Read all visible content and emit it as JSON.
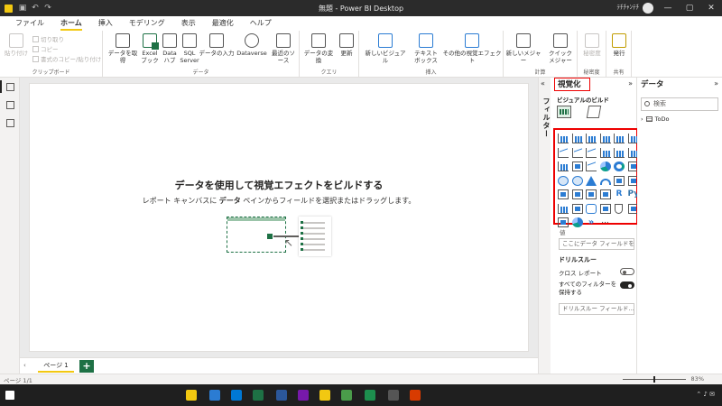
{
  "window": {
    "title": "無題 - Power BI Desktop",
    "user": "ﾃﾁﾁｬﾝﾃﾁ"
  },
  "menu": {
    "tabs": [
      "ファイル",
      "ホーム",
      "挿入",
      "モデリング",
      "表示",
      "最適化",
      "ヘルプ"
    ],
    "active": "ホーム"
  },
  "ribbon": {
    "clipboard": {
      "paste": "貼り付け",
      "cut": "切り取り",
      "copy": "コピー",
      "format_painter": "書式のコピー/貼り付け",
      "label": "クリップボード"
    },
    "data": {
      "get_data": "データを取得",
      "excel": "Excel ブック",
      "datahub": "Data ハブ",
      "sql": "SQL Server",
      "enter_data": "データの入力",
      "dataverse": "Dataverse",
      "recent": "最近のソース",
      "label": "データ"
    },
    "query": {
      "transform": "データの変換",
      "refresh": "更新",
      "label": "クエリ"
    },
    "insert": {
      "new_visual": "新しいビジュアル",
      "textbox": "テキスト ボックス",
      "more_visuals": "その他の視覚エフェクト",
      "label": "挿入"
    },
    "calculations": {
      "new_measure": "新しいメジャー",
      "quick_measure": "クイック メジャー",
      "label": "計算"
    },
    "sensitivity": {
      "btn": "秘密度",
      "label": "秘密度"
    },
    "share": {
      "publish": "発行",
      "label": "共有"
    }
  },
  "canvas": {
    "empty_title": "データを使用して視覚エフェクトをビルドする",
    "empty_sub_1": "レポート キャンバスに ",
    "empty_sub_bold": "データ",
    "empty_sub_2": " ペインからフィールドを選択またはドラッグします。"
  },
  "pages": {
    "tabs": [
      "ページ 1"
    ],
    "add_label": "+"
  },
  "filters": {
    "label": "フィルター"
  },
  "visualizations": {
    "title": "視覚化",
    "build_label": "ビジュアルのビルド",
    "values_label": "値",
    "values_placeholder": "ここにデータ フィールドを...",
    "drill_label": "ドリルスルー",
    "cross_report": "クロス レポート",
    "keep_filters": "すべてのフィルターを保持する",
    "drill_placeholder": "ドリルスルー フィールド...",
    "more": "..."
  },
  "data_pane": {
    "title": "データ",
    "search_placeholder": "検索",
    "tables": [
      "ToDo"
    ]
  },
  "status": {
    "page": "ページ 1/1",
    "zoom": "83%"
  },
  "colors": {
    "accent": "#f2c811",
    "highlight_box": "#e00000",
    "pbi_green": "#1e7145"
  }
}
